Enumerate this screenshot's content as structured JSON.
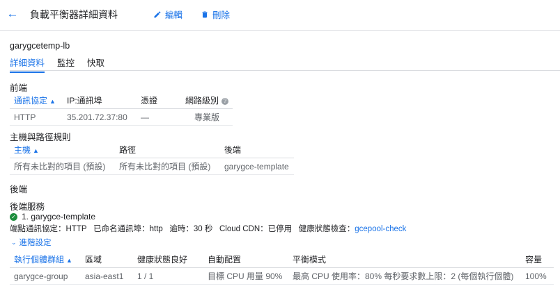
{
  "header": {
    "title": "負載平衡器詳細資料",
    "edit_label": "編輯",
    "delete_label": "刪除"
  },
  "lb_name": "garygcetemp-lb",
  "tabs": [
    {
      "label": "詳細資料",
      "active": true
    },
    {
      "label": "監控",
      "active": false
    },
    {
      "label": "快取",
      "active": false
    }
  ],
  "frontend": {
    "title": "前端",
    "columns": [
      "通訊協定",
      "IP:通訊埠",
      "憑證",
      "網路級別"
    ],
    "rows": [
      {
        "protocol": "HTTP",
        "ip_port": "35.201.72.37:80",
        "cert": "—",
        "tier": "專業版"
      }
    ]
  },
  "rules": {
    "title": "主機與路徑規則",
    "columns": [
      "主機",
      "路徑",
      "後端"
    ],
    "rows": [
      {
        "host": "所有未比對的項目 (預設)",
        "path": "所有未比對的項目 (預設)",
        "backend": "garygce-template"
      }
    ]
  },
  "backend": {
    "title": "後端",
    "services_title": "後端服務",
    "service_name": "1. garygce-template",
    "meta_endpoint_protocol": "端點通訊協定：HTTP",
    "meta_named_port": "已命名通訊埠：http",
    "meta_timeout": "逾時：30 秒",
    "meta_cdn": "Cloud CDN：已停用",
    "meta_health_label": "健康狀態檢查：",
    "meta_health_link": "gcepool-check",
    "advanced_label": "進階設定",
    "columns": [
      "執行個體群組",
      "區域",
      "健康狀態良好",
      "自動配置",
      "平衡模式",
      "容量"
    ],
    "rows": [
      {
        "group": "garygce-group",
        "zone": "asia-east1",
        "healthy": "1 / 1",
        "autoscale": "目標 CPU 用量 90%",
        "balance": "最高 CPU 使用率：80% 每秒要求數上限：2 (每個執行個體)",
        "capacity": "100%"
      }
    ]
  },
  "colors": {
    "accent": "#1a73e8",
    "success": "#1e8e3e"
  },
  "icons": [
    "arrow-back-icon",
    "pencil-icon",
    "trash-icon",
    "help-icon",
    "check-circle-icon",
    "chevron-down-icon",
    "sort-up-icon"
  ]
}
